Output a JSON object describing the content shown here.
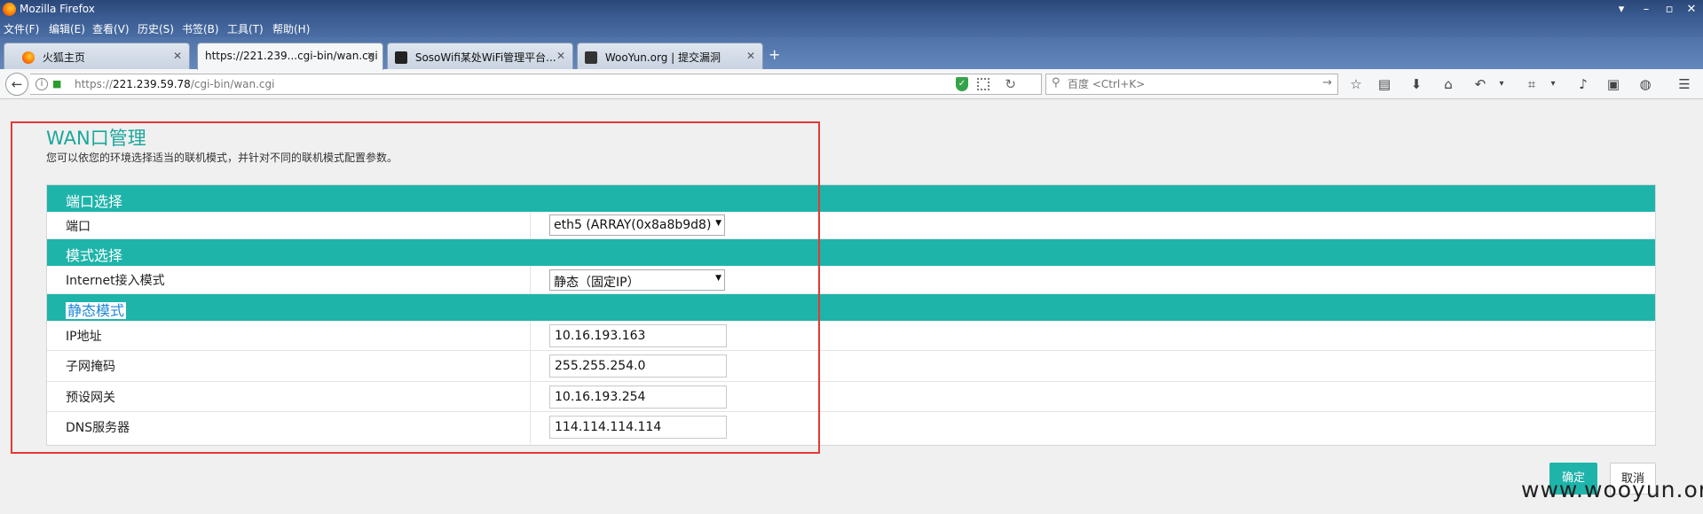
{
  "window": {
    "title": "Mozilla Firefox",
    "controls": {
      "dropdown": "▾",
      "minimize": "–",
      "restore": "▫",
      "close": "✕"
    }
  },
  "menubar": [
    "文件(F)",
    "编辑(E)",
    "查看(V)",
    "历史(S)",
    "书签(B)",
    "工具(T)",
    "帮助(H)"
  ],
  "tabs": [
    {
      "label": "火狐主页",
      "icon": "firefox-icon"
    },
    {
      "label": "https://221.239...cgi-bin/wan.cgi",
      "icon": "",
      "active": true
    },
    {
      "label": "SosoWifi某处WiFi管理平台...",
      "icon": "wifi-logo-icon"
    },
    {
      "label": "WooYun.org | 提交漏洞",
      "icon": "wooyun-logo-icon"
    }
  ],
  "new_tab": "+",
  "navbar": {
    "back": "←",
    "url_prefix": "https://",
    "url_host": "221.239.59.78",
    "url_path": "/cgi-bin/wan.cgi",
    "search_placeholder": "百度 <Ctrl+K>",
    "shield_glyph": "✓"
  },
  "page": {
    "title": "WAN口管理",
    "description": "您可以依您的环境选择适当的联机模式，并针对不同的联机模式配置参数。",
    "sections": {
      "port": {
        "heading": "端口选择",
        "row_label": "端口",
        "select_value": "eth5 (ARRAY(0x8a8b9d8)"
      },
      "mode": {
        "heading": "模式选择",
        "row_label": "Internet接入模式",
        "select_value": "静态（固定IP）"
      },
      "static": {
        "heading": "静态模式",
        "fields": [
          {
            "label": "IP地址",
            "value": "10.16.193.163"
          },
          {
            "label": "子网掩码",
            "value": "255.255.254.0"
          },
          {
            "label": "预设网关",
            "value": "10.16.193.254"
          },
          {
            "label": "DNS服务器",
            "value": "114.114.114.114"
          }
        ]
      }
    },
    "buttons": {
      "ok": "确定",
      "cancel": "取消"
    }
  },
  "watermark": "www.wooyun.org",
  "colors": {
    "accent": "#1fb4aa",
    "title": "#1ca79c",
    "highlight_border": "#e53935"
  }
}
